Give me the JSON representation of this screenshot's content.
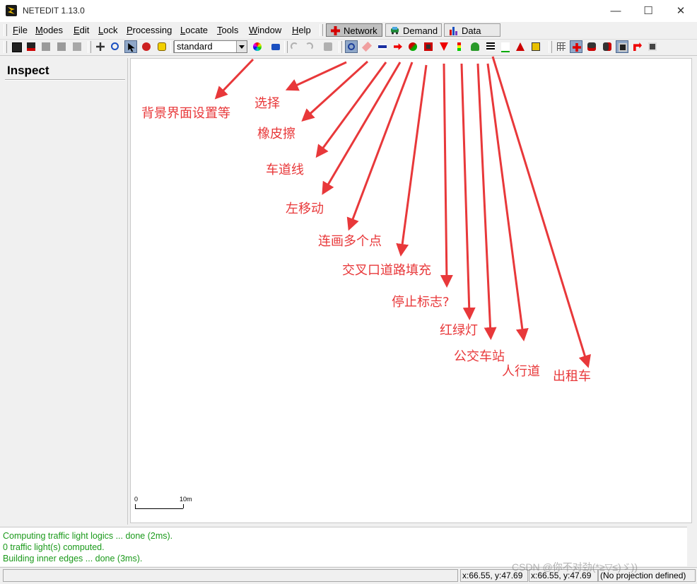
{
  "window": {
    "title": "NETEDIT 1.13.0",
    "minimize": "—",
    "maximize": "☐",
    "close": "✕"
  },
  "menus": [
    {
      "pre": "",
      "ul": "F",
      "post": "ile"
    },
    {
      "pre": "",
      "ul": "M",
      "post": "odes"
    },
    {
      "pre": "",
      "ul": "E",
      "post": "dit"
    },
    {
      "pre": "",
      "ul": "L",
      "post": "ock"
    },
    {
      "pre": "",
      "ul": "P",
      "post": "rocessing"
    },
    {
      "pre": "",
      "ul": "L",
      "post": "ocate"
    },
    {
      "pre": "",
      "ul": "T",
      "post": "ools"
    },
    {
      "pre": "",
      "ul": "W",
      "post": "indow"
    },
    {
      "pre": "",
      "ul": "H",
      "post": "elp"
    }
  ],
  "supermodes": [
    "Network",
    "Demand",
    "Data"
  ],
  "toolbar": {
    "scheme": "standard"
  },
  "icons": {
    "file": [
      "save-network-icon",
      "save-all-icon",
      "save-additionals-icon",
      "save-demand-icon",
      "save-data-icon"
    ],
    "view": [
      "recenter-icon",
      "locate-icon",
      "select-pointer-icon",
      "colorwheel-icon",
      "tooltip-icon"
    ],
    "edit": [
      "undo-icon",
      "redo-icon",
      "compute-junctions-icon"
    ],
    "modes": [
      "inspect-mode-icon",
      "delete-mode-icon",
      "select-mode-icon",
      "move-mode-icon",
      "create-edge-icon",
      "connection-mode-icon",
      "prohibition-mode-icon",
      "traffic-light-mode-icon",
      "additional-mode-icon",
      "crossing-mode-icon",
      "taz-mode-icon",
      "shape-mode-icon",
      "wire-mode-icon"
    ],
    "right": [
      "grid-icon",
      "junction-shape-icon",
      "vehicle-icon",
      "overlapping-vehicle-icon",
      "lane-icon",
      "spread-icon",
      "zoom-icon"
    ]
  },
  "side": {
    "title": "Inspect"
  },
  "scale": {
    "start": "0",
    "end": "10m"
  },
  "messages": [
    "Computing traffic light logics ... done (2ms).",
    " 0 traffic light(s) computed.",
    "Building inner edges ... done (3ms)."
  ],
  "status": {
    "coord1": "x:66.55, y:47.69",
    "coord2": "x:66.55, y:47.69",
    "projection": "(No projection defined)"
  },
  "watermark": "CSDN @你不对劲(*≥▽≤)ゞ))",
  "annotations": [
    "背景界面设置等",
    "选择",
    "橡皮擦",
    "车道线",
    "左移动",
    "连画多个点",
    "交叉口道路填充",
    "停止标志?",
    "红绿灯",
    "公交车站",
    "人行道",
    "出租车"
  ],
  "colors": {
    "annotation": "#e8383a",
    "log": "#1b9a1b",
    "pressed": "#8fa7c8"
  }
}
